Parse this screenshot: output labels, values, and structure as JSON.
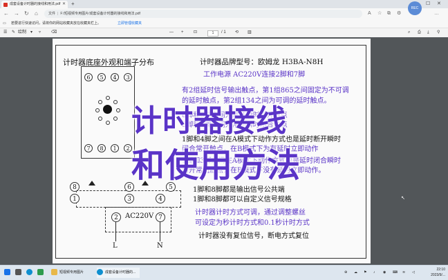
{
  "browser": {
    "tab_title": "成套设备计时器的接线和用法.pdf",
    "address": "F:/短视频专用图片/成套设备计时器的接线和用法.pdf",
    "address_prefix": "文件",
    "bookmark_hint": "若要进行快速访问，请将你的网站收藏夹放在收藏夹栏上。",
    "bookmark_link": "立即管理收藏夹",
    "bookmark_tab": "在此页"
  },
  "pdf_toolbar": {
    "draw_label": "绘制",
    "page_current": "1",
    "page_total": "/ 1"
  },
  "doc": {
    "left_title": "计时器底座外观和端子分布",
    "right_title": "计时器品牌型号：欧姆龙 H3BA-N8H",
    "power_line": "工作电源 AC220V连接2脚和7脚",
    "desc1a": "有2组延时信号输出触点，第1组865之间固定为不可调",
    "desc1b": "的延时触点，第2组134之间为可调的延时触点。",
    "desc2a": "8脚和6脚之间为常开瞬时断开触点",
    "desc2b": "8脚和5脚之间为常闭瞬时闭合触点",
    "desc3a": "1脚和4脚之间在A模式下动作方式也是延时断开瞬时",
    "desc3b": "闭合常开触点，在B模式下为有延时立即动作",
    "desc4a": "1脚和3脚之间在A模式下动作方式也是延时闭合瞬时",
    "desc4b": "断开常闭触点，在B模式下没有延时立即动作。",
    "common1": "1脚和8脚都是输出信号公共端",
    "common2": "1脚和8脚都可以自定义信号规格",
    "mode1": "计时器计时方式可调，通过调整螺丝",
    "mode2": "可设定为秒计时方式和0.1秒计时方式",
    "reset": "计时器没有复位信号，断电方式复位",
    "ac": "AC220V",
    "L": "L",
    "N": "N",
    "pins_top": [
      "6",
      "5",
      "4",
      "3"
    ],
    "pins_bottom": [
      "7",
      "8",
      "1",
      "2"
    ],
    "circ_top": [
      "8",
      "6",
      "5"
    ],
    "circ_mid": [
      "1",
      "3",
      "4"
    ],
    "circ_coil": [
      "2",
      "7"
    ]
  },
  "overlay": {
    "line1": "计时器接线",
    "line2": "和使用方法"
  },
  "taskbar": {
    "item1": "短视频专用图片",
    "item2": "成套设备计时器的..."
  },
  "clock": {
    "time": "22:10",
    "date": "2023/9/..."
  },
  "colors": {
    "accent": "#5a34c7",
    "ink": "#111111"
  }
}
